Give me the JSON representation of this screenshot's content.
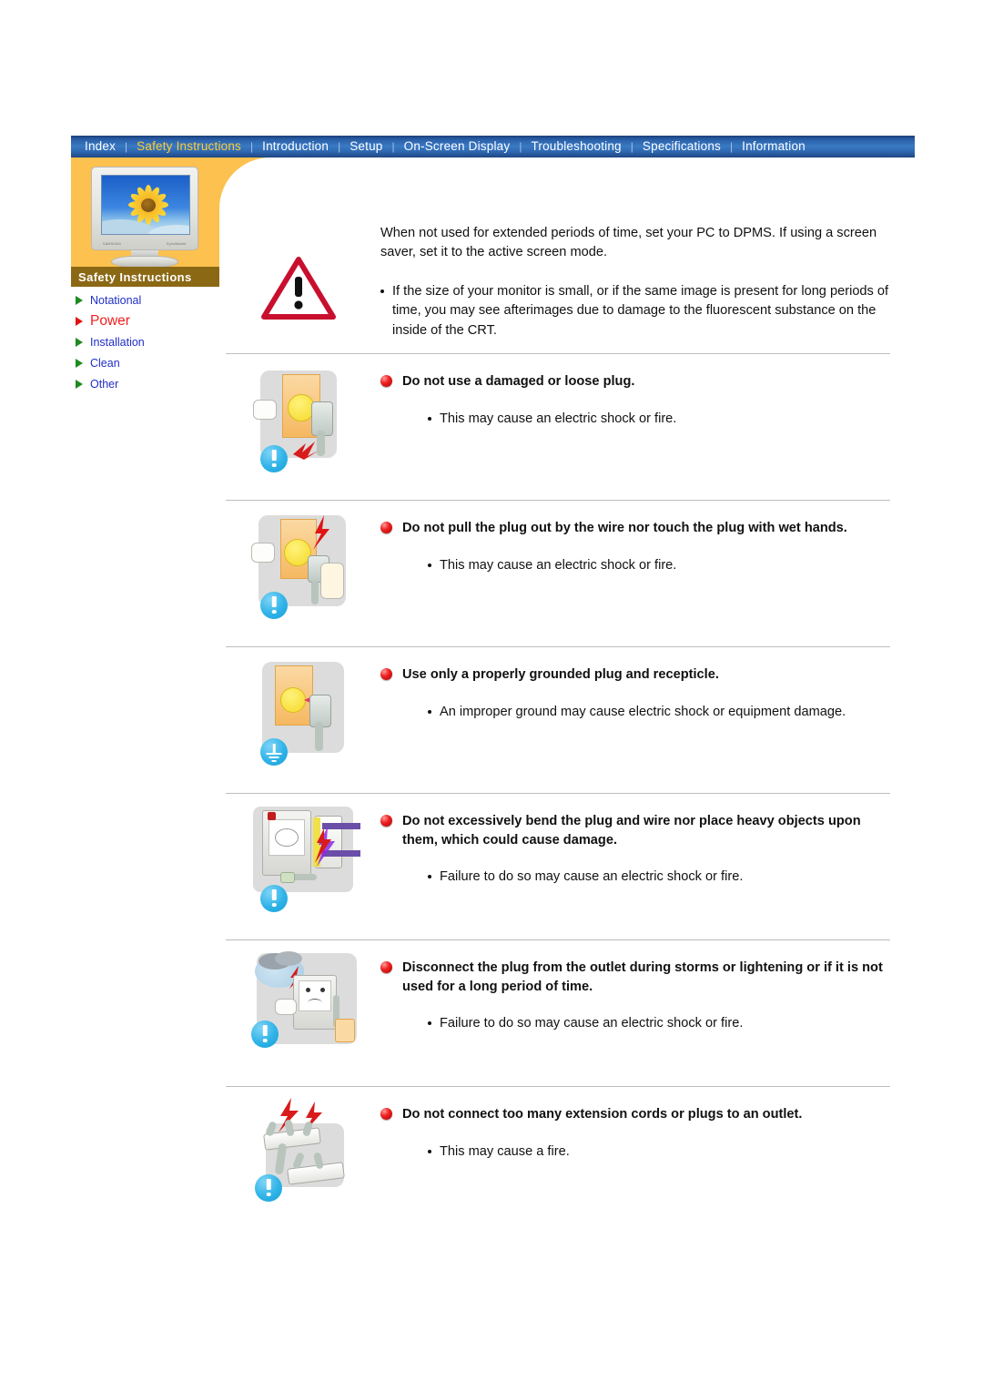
{
  "nav": {
    "items": [
      {
        "label": "Index",
        "active": false
      },
      {
        "label": "Safety Instructions",
        "active": true
      },
      {
        "label": "Introduction",
        "active": false
      },
      {
        "label": "Setup",
        "active": false
      },
      {
        "label": "On-Screen Display",
        "active": false
      },
      {
        "label": "Troubleshooting",
        "active": false
      },
      {
        "label": "Specifications",
        "active": false
      },
      {
        "label": "Information",
        "active": false
      }
    ],
    "separator": "|"
  },
  "sidebar": {
    "caption": "Safety Instructions",
    "monitor_brand_left": "SAMSUNG",
    "monitor_brand_right": "SyncMaster",
    "items": [
      {
        "label": "Notational",
        "current": false
      },
      {
        "label": "Power",
        "current": true
      },
      {
        "label": "Installation",
        "current": false
      },
      {
        "label": "Clean",
        "current": false
      },
      {
        "label": "Other",
        "current": false
      }
    ]
  },
  "intro": {
    "paragraph": "When not used for extended periods of time, set your PC to DPMS. If using a screen saver, set it to the active screen mode.",
    "bullet": "If the size of your monitor is small, or if the same image is present for long periods of time, you may see afterimages due to damage to the fluorescent substance on the inside of the CRT."
  },
  "sections": [
    {
      "title": "Do not use a damaged or loose plug.",
      "bullet": "This may cause an electric shock or fire.",
      "icon": "exclamation-circle-icon",
      "figure": "damaged-plug-illustration"
    },
    {
      "title": "Do not pull the plug out by the wire nor touch the plug with wet hands.",
      "bullet": "This may cause an electric shock or fire.",
      "icon": "exclamation-circle-icon",
      "figure": "wet-hands-plug-illustration"
    },
    {
      "title": "Use only a properly grounded plug and recepticle.",
      "bullet": "An improper ground may cause electric shock or equipment damage.",
      "icon": "ground-circle-icon",
      "figure": "grounded-plug-illustration"
    },
    {
      "title": "Do not excessively bend the plug and wire nor place heavy objects upon them, which could cause damage.",
      "bullet": "Failure to do so may cause an electric shock or fire.",
      "icon": "exclamation-circle-icon",
      "figure": "bent-wire-monitor-illustration"
    },
    {
      "title": "Disconnect the plug from the outlet during storms or lightening or if it is not used for a long period of time.",
      "bullet": "Failure to do so may cause an electric shock or fire.",
      "icon": "exclamation-circle-icon",
      "figure": "storm-monitor-illustration"
    },
    {
      "title": "Do not connect too many extension cords or plugs to an outlet.",
      "bullet": "This may cause a fire.",
      "icon": "exclamation-circle-icon",
      "figure": "extension-cords-illustration"
    }
  ],
  "colors": {
    "nav_bg": "#2a5fa8",
    "nav_active_text": "#ffcc33",
    "sidebar_orange": "#fcc14e",
    "sidebar_caption_bg": "#8b6914",
    "menu_link": "#1f2ec6",
    "menu_current": "#ef2020",
    "bullet_red": "#ee2020",
    "icon_blue": "#2fb3e8",
    "warning_red": "#c8102e"
  }
}
